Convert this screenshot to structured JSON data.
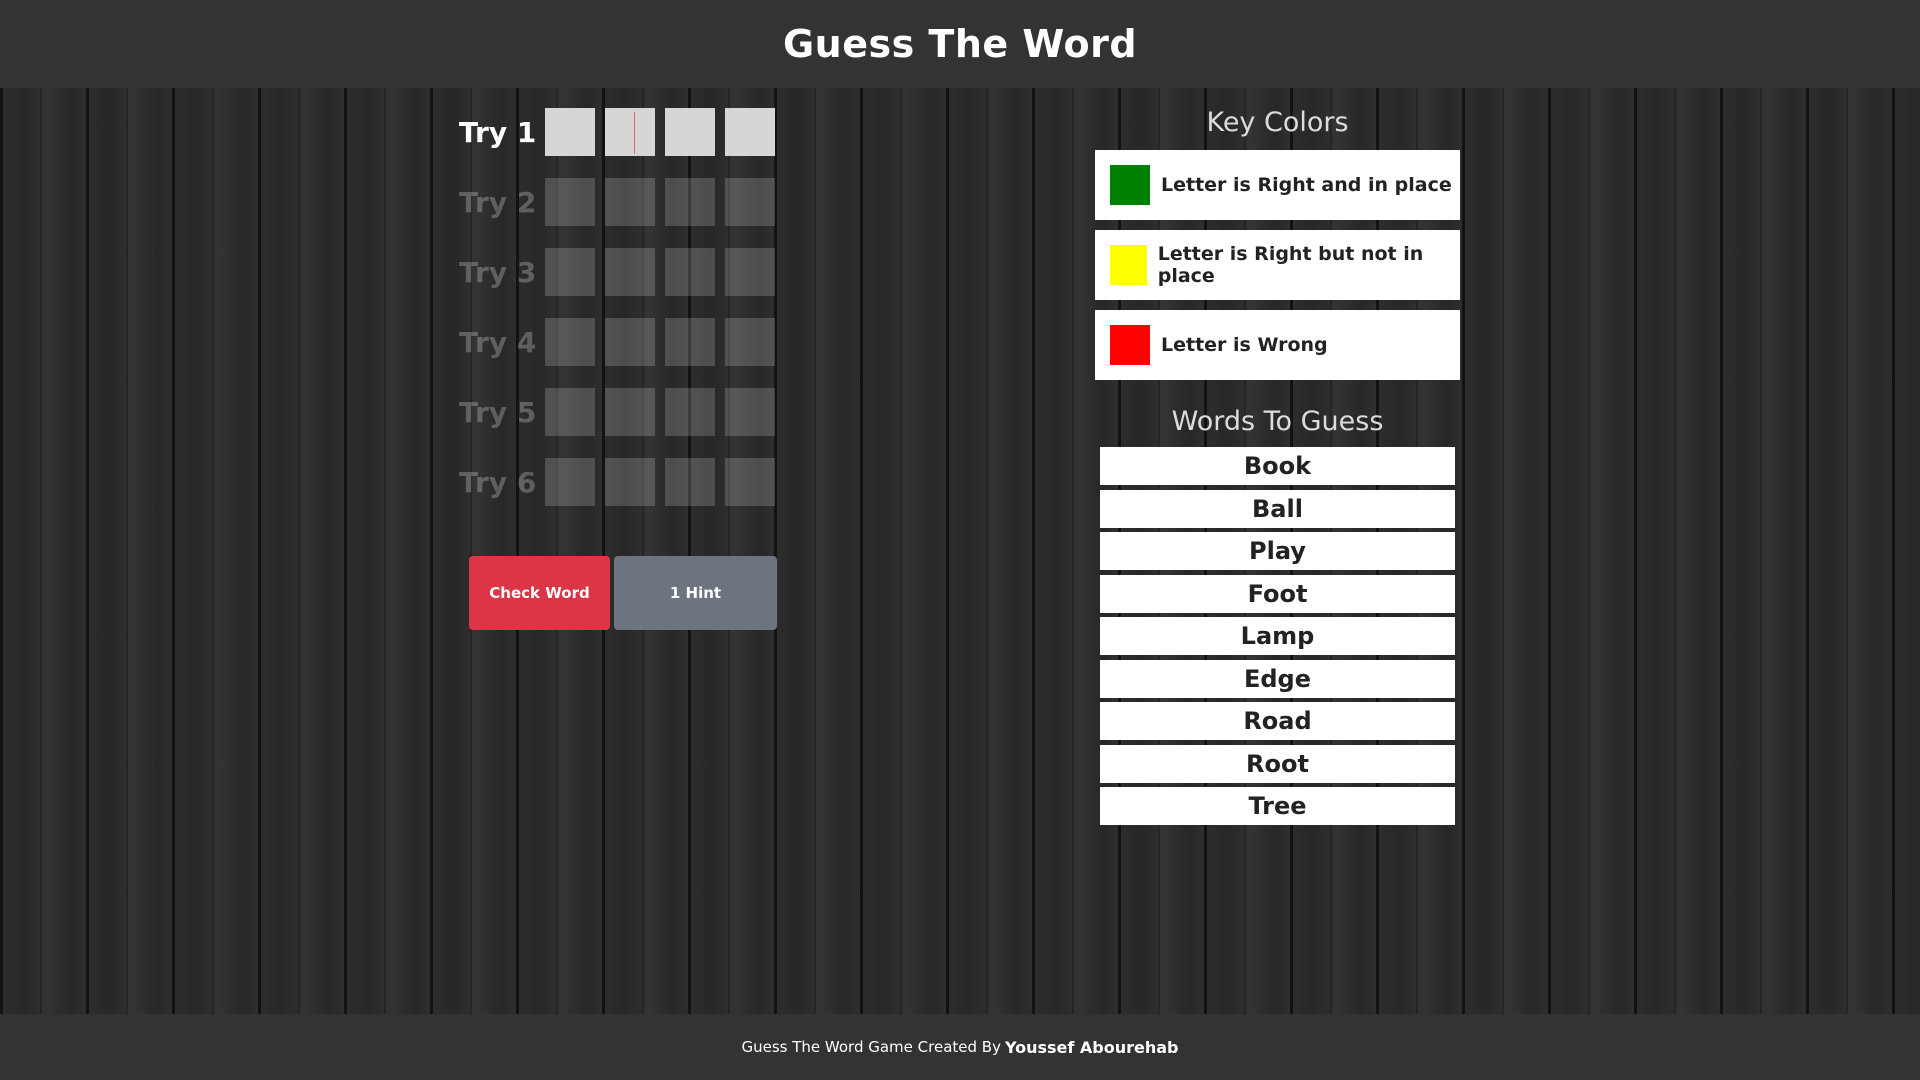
{
  "header": {
    "title": "Guess The Word"
  },
  "tries": [
    {
      "label": "Try 1",
      "active": true
    },
    {
      "label": "Try 2",
      "active": false
    },
    {
      "label": "Try 3",
      "active": false
    },
    {
      "label": "Try 4",
      "active": false
    },
    {
      "label": "Try 5",
      "active": false
    },
    {
      "label": "Try 6",
      "active": false
    }
  ],
  "letters_per_try": 4,
  "buttons": {
    "check_label": "Check Word",
    "hint_label": "1 Hint"
  },
  "key_colors": {
    "title": "Key Colors",
    "items": [
      {
        "color": "#008000",
        "text": "Letter is Right and in place"
      },
      {
        "color": "#ffff00",
        "text": "Letter is Right but not in place"
      },
      {
        "color": "#ff0000",
        "text": "Letter is Wrong"
      }
    ]
  },
  "words": {
    "title": "Words To Guess",
    "list": [
      "Book",
      "Ball",
      "Play",
      "Foot",
      "Lamp",
      "Edge",
      "Road",
      "Root",
      "Tree"
    ]
  },
  "footer": {
    "text": "Guess The Word Game Created By",
    "author": "Youssef Abourehab"
  },
  "colors": {
    "accent_red": "#dc3545",
    "hint_gray": "#6c757d",
    "bar_bg": "#333333"
  }
}
